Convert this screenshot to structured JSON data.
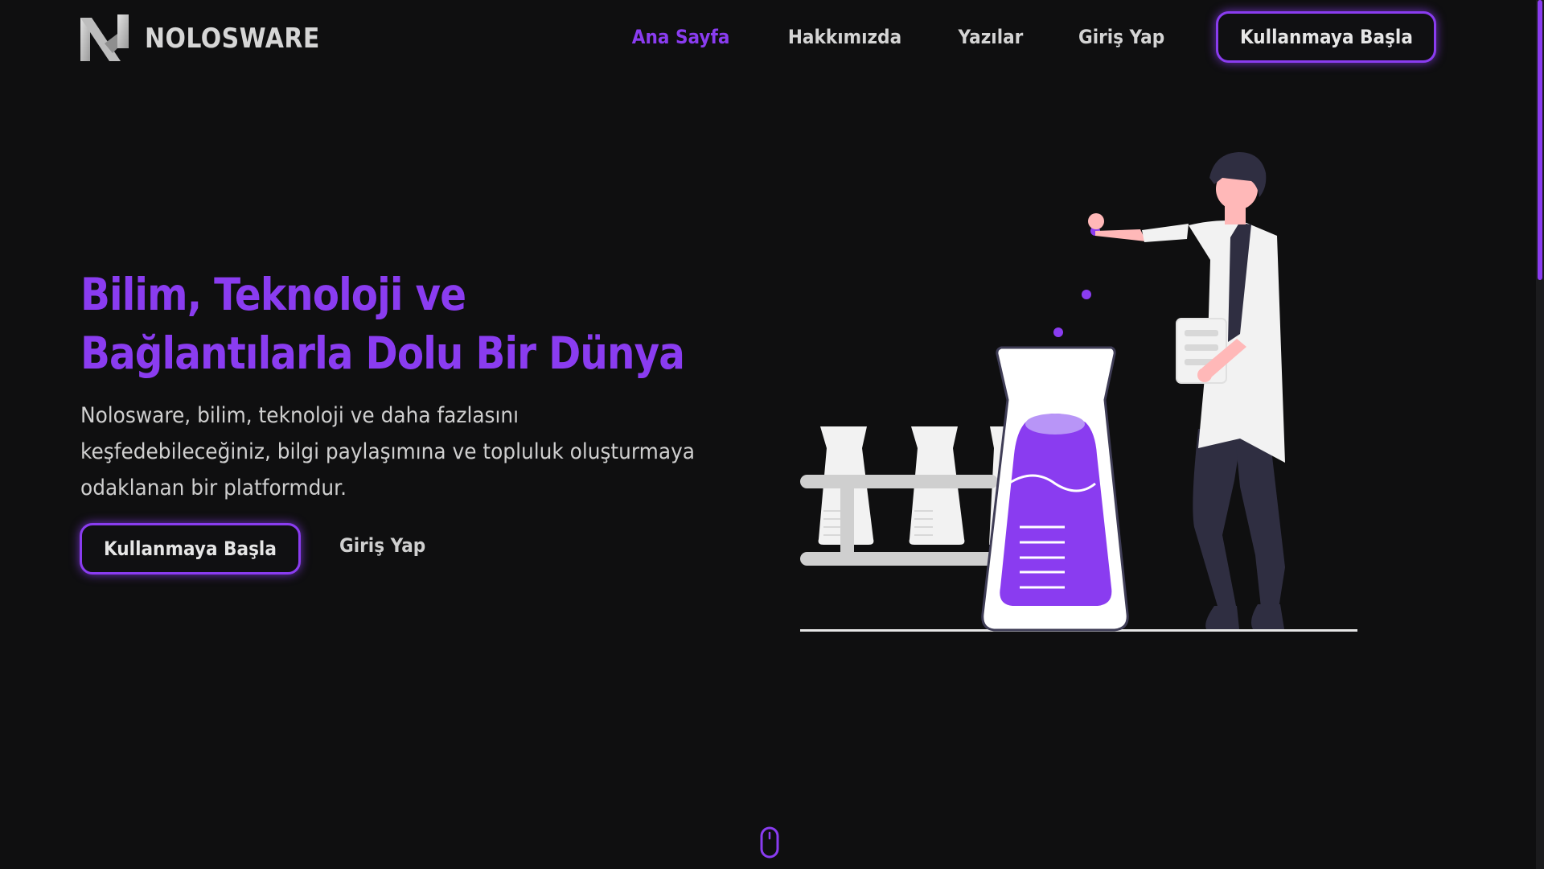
{
  "brand": {
    "name": "NOLOSWARE",
    "accent_color": "#8a3cf0",
    "background_color": "#0f0f10"
  },
  "nav": {
    "items": [
      {
        "label": "Ana Sayfa",
        "active": true
      },
      {
        "label": "Hakkımızda",
        "active": false
      },
      {
        "label": "Yazılar",
        "active": false
      },
      {
        "label": "Giriş Yap",
        "active": false
      }
    ],
    "cta_label": "Kullanmaya Başla"
  },
  "hero": {
    "title_lines": [
      "Bilim, Teknoloji ve",
      "Bağlantılarla Dolu Bir Dünya"
    ],
    "description_lines": [
      "Nolosware, bilim, teknoloji ve daha fazlasını",
      "keşfedebileceğiniz, bilgi paylaşımına ve topluluk oluşturmaya",
      "odaklanan bir platformdur."
    ],
    "primary_button": "Kullanmaya Başla",
    "secondary_button": "Giriş Yap"
  },
  "illustration": {
    "subject": "scientist-with-flasks"
  },
  "scroll_indicator": {
    "icon": "mouse-scroll-icon"
  }
}
